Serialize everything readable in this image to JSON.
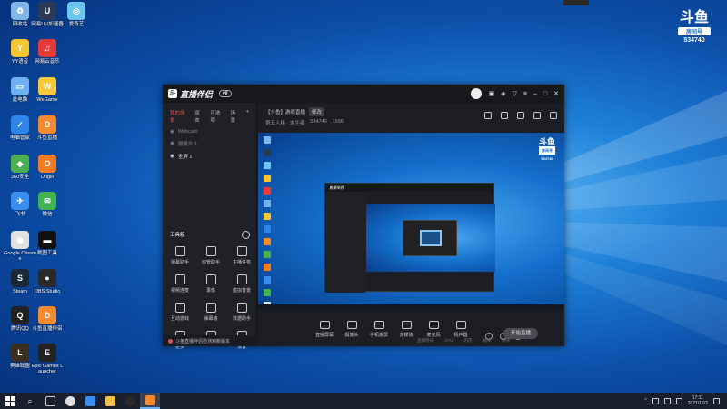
{
  "desktop": {
    "icons": [
      {
        "label": "回收站",
        "color": "#7fb7e8",
        "glyph": "♻"
      },
      {
        "label": "网易UU加速器",
        "color": "#2b3a55",
        "glyph": "U"
      },
      {
        "label": "爱奇艺",
        "color": "#6dc5f2",
        "glyph": "◎"
      },
      {
        "label": "YY语音",
        "color": "#f5c534",
        "glyph": "Y"
      },
      {
        "label": "网易云音乐",
        "color": "#e33a3a",
        "glyph": "♫"
      },
      {
        "label": "此电脑",
        "color": "#6fb1f0",
        "glyph": "▭"
      },
      {
        "label": "WeGame",
        "color": "#f7c93a",
        "glyph": "W"
      },
      {
        "label": "电脑管家",
        "color": "#2f86e8",
        "glyph": "✓"
      },
      {
        "label": "斗鱼直播",
        "color": "#f58a2f",
        "glyph": "D"
      },
      {
        "label": "360安全",
        "color": "#4caf50",
        "glyph": "◆"
      },
      {
        "label": "Origin",
        "color": "#f47b20",
        "glyph": "O"
      },
      {
        "label": "飞书",
        "color": "#3a8ef0",
        "glyph": "✈"
      },
      {
        "label": "微信",
        "color": "#3fb34f",
        "glyph": "✉"
      },
      {
        "label": "Google Chrome",
        "color": "#e0e0e0",
        "glyph": "◉"
      },
      {
        "label": "截图工具",
        "color": "#111111",
        "glyph": "▬"
      },
      {
        "label": "Steam",
        "color": "#1b2838",
        "glyph": "S"
      },
      {
        "label": "OBS Studio",
        "color": "#2a2a2a",
        "glyph": "●"
      },
      {
        "label": "腾讯QQ",
        "color": "#222222",
        "glyph": "Q"
      },
      {
        "label": "斗鱼直播伴侣",
        "color": "#f58a2f",
        "glyph": "D"
      },
      {
        "label": "英雄联盟",
        "color": "#3b2f1f",
        "glyph": "L"
      },
      {
        "label": "Epic Games Launcher",
        "color": "#222222",
        "glyph": "E"
      }
    ]
  },
  "brand": {
    "logo": "斗鱼",
    "room_label": "房间号",
    "room_number": "534740"
  },
  "app": {
    "title": "直播伴侣",
    "version": "v6",
    "left_tabs": [
      "我的场景",
      "双击",
      "可选项",
      "场景"
    ],
    "scenes": [
      {
        "name": "Webcam",
        "active": false
      },
      {
        "name": "摄像头 1",
        "active": false
      },
      {
        "name": "全屏 1",
        "active": true
      }
    ],
    "tools_title": "工具箱",
    "tools": [
      "弹幕助手",
      "房管助手",
      "主播任务",
      "视频连麦",
      "录像",
      "虚拟背景",
      "互动游戏",
      "弹幕墙",
      "数据助手",
      "更多",
      "",
      "设置"
    ],
    "footer_message": "斗鱼直播伴侣检测到新版本",
    "room": {
      "category": "【斗鱼】游戏直播",
      "tag": "修改",
      "subtitle": "第五人格 · 求生者",
      "followers": "534740",
      "hot": "1596"
    },
    "toolbar": [
      "直播屏幕",
      "摄像头",
      "手机投屏",
      "多媒体",
      "麦克风",
      "扬声器"
    ],
    "start_button": "开始直播",
    "status": [
      "直播时长",
      "CPU",
      "内存",
      "帧率",
      "码率"
    ]
  },
  "preview_brand": {
    "logo": "斗鱼",
    "room_label": "房间号",
    "room_number": "534740"
  },
  "taskbar": {
    "time": "17:11",
    "date": "2021/12/2"
  }
}
